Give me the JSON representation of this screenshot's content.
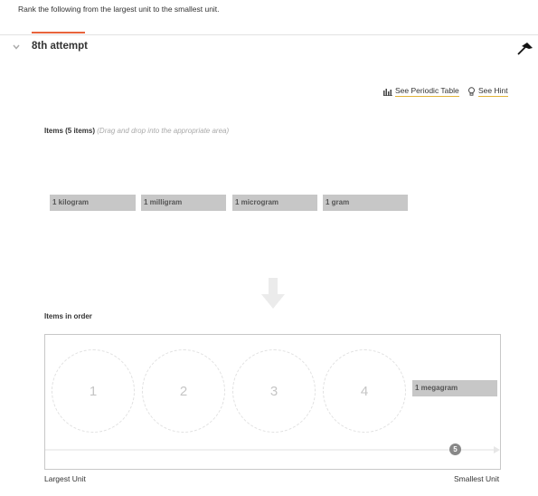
{
  "question": "Rank the following from the largest unit to the smallest unit.",
  "attempt": {
    "title": "8th attempt"
  },
  "toolbar": {
    "periodic_table": "See Periodic Table",
    "hint": "See Hint"
  },
  "items_section": {
    "title": "Items (5 items)",
    "instruction": "(Drag and drop into the appropriate area)",
    "items": [
      "1 kilogram",
      "1 milligram",
      "1 microgram",
      "1 gram"
    ]
  },
  "order_section": {
    "title": "Items in order",
    "slots": [
      "1",
      "2",
      "3",
      "4"
    ],
    "placed_item": "1 megagram",
    "placed_position": "5",
    "left_label": "Largest Unit",
    "right_label": "Smallest Unit"
  },
  "colors": {
    "accent": "#e8643c",
    "link_underline": "#e0b33a",
    "chip": "#c7c7c7"
  },
  "icons": [
    "chevron-down-icon",
    "flag-icon",
    "periodic-table-icon",
    "lightbulb-icon",
    "down-arrow-icon",
    "arrow-right-icon"
  ]
}
